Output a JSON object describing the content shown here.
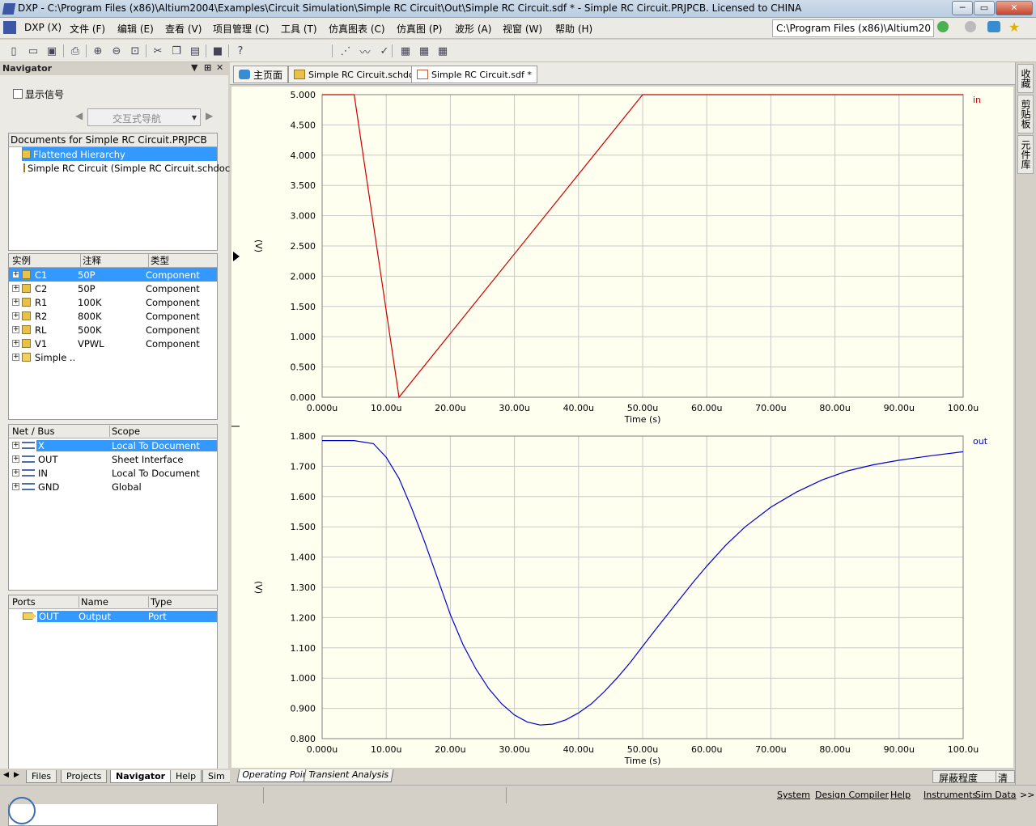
{
  "window": {
    "title": "DXP - C:\\Program Files (x86)\\Altium2004\\Examples\\Circuit Simulation\\Simple RC Circuit\\Out\\Simple RC Circuit.sdf * - Simple RC Circuit.PRJPCB. Licensed to CHINA",
    "buttons": {
      "minimize": "─",
      "maximize": "▭",
      "close": "✕"
    }
  },
  "menu": {
    "items": [
      {
        "label": "DXP (X)"
      },
      {
        "label": "文件 (F)"
      },
      {
        "label": "编辑 (E)"
      },
      {
        "label": "查看 (V)"
      },
      {
        "label": "项目管理 (C)"
      },
      {
        "label": "工具 (T)"
      },
      {
        "label": "仿真图表 (C)"
      },
      {
        "label": "仿真图 (P)"
      },
      {
        "label": "波形 (A)"
      },
      {
        "label": "视窗 (W)"
      },
      {
        "label": "帮助 (H)"
      }
    ],
    "path": "C:\\Program Files (x86)\\Altium20"
  },
  "navigator": {
    "title": "Navigator",
    "show_signals": "显示信号",
    "interactive_nav": "交互式导航",
    "documents": {
      "header": "Documents for Simple RC Circuit.PRJPCB",
      "items": [
        "Flattened Hierarchy",
        "Simple RC Circuit (Simple RC Circuit.schdoc)"
      ]
    },
    "instances": {
      "headers": [
        "实例",
        "注释",
        "类型"
      ],
      "rows": [
        [
          "C1",
          "50P",
          "Component"
        ],
        [
          "C2",
          "50P",
          "Component"
        ],
        [
          "R1",
          "100K",
          "Component"
        ],
        [
          "R2",
          "800K",
          "Component"
        ],
        [
          "RL",
          "500K",
          "Component"
        ],
        [
          "V1",
          "VPWL",
          "Component"
        ],
        [
          "Simple ...",
          "",
          ""
        ]
      ]
    },
    "nets": {
      "headers": [
        "Net / Bus",
        "Scope"
      ],
      "rows": [
        [
          "X",
          "Local To Document"
        ],
        [
          "OUT",
          "Sheet Interface"
        ],
        [
          "IN",
          "Local To Document"
        ],
        [
          "GND",
          "Global"
        ]
      ]
    },
    "ports": {
      "headers": [
        "Ports",
        "Name",
        "Type"
      ],
      "rows": [
        [
          "OUT",
          "Output",
          "Port"
        ]
      ]
    },
    "bottom_tabs": [
      "Files",
      "Projects",
      "Navigator",
      "Help",
      "Sim"
    ]
  },
  "doc_tabs": [
    "主页面",
    "Simple RC Circuit.schdoc",
    "Simple RC Circuit.sdf *"
  ],
  "sheet_tabs": [
    "Operating Point",
    "Transient Analysis"
  ],
  "sheet_buttons": [
    "屏蔽程度",
    "清除"
  ],
  "right_tabs": [
    "收藏",
    "剪贴板",
    "元件库"
  ],
  "status_buttons": [
    "System",
    "Design Compiler",
    "Help",
    "Instruments",
    "Sim Data",
    ">>"
  ],
  "chart_data": [
    {
      "type": "line",
      "ylabel": "(V)",
      "xlabel": "Time (s)",
      "ylim": [
        0,
        5
      ],
      "xlim": [
        0,
        100
      ],
      "yticks": [
        "0.000",
        "0.500",
        "1.000",
        "1.500",
        "2.000",
        "2.500",
        "3.000",
        "3.500",
        "4.000",
        "4.500",
        "5.000"
      ],
      "xticks": [
        "0.000u",
        "10.00u",
        "20.00u",
        "30.00u",
        "40.00u",
        "50.00u",
        "60.00u",
        "70.00u",
        "80.00u",
        "90.00u",
        "100.0u"
      ],
      "grid": true,
      "series": [
        {
          "name": "in",
          "color": "#cc0000",
          "x": [
            0,
            5,
            12,
            50,
            100
          ],
          "y": [
            5,
            5,
            0,
            5,
            5
          ]
        }
      ]
    },
    {
      "type": "line",
      "ylabel": "(V)",
      "xlabel": "Time (s)",
      "ylim": [
        0.8,
        1.8
      ],
      "xlim": [
        0,
        100
      ],
      "yticks": [
        "0.800",
        "0.900",
        "1.000",
        "1.100",
        "1.200",
        "1.300",
        "1.400",
        "1.500",
        "1.600",
        "1.700",
        "1.800"
      ],
      "xticks": [
        "0.000u",
        "10.00u",
        "20.00u",
        "30.00u",
        "40.00u",
        "50.00u",
        "60.00u",
        "70.00u",
        "80.00u",
        "90.00u",
        "100.0u"
      ],
      "grid": true,
      "series": [
        {
          "name": "out",
          "color": "#0000cc",
          "x": [
            0,
            5,
            8,
            10,
            12,
            14,
            16,
            18,
            20,
            22,
            24,
            26,
            28,
            30,
            32,
            34,
            36,
            38,
            40,
            42,
            44,
            46,
            48,
            50,
            52,
            55,
            58,
            60,
            63,
            66,
            70,
            74,
            78,
            82,
            86,
            90,
            95,
            100
          ],
          "y": [
            1.785,
            1.785,
            1.775,
            1.73,
            1.66,
            1.56,
            1.45,
            1.33,
            1.21,
            1.11,
            1.03,
            0.965,
            0.915,
            0.878,
            0.855,
            0.845,
            0.848,
            0.862,
            0.885,
            0.915,
            0.955,
            1.0,
            1.05,
            1.105,
            1.16,
            1.24,
            1.32,
            1.37,
            1.44,
            1.5,
            1.565,
            1.615,
            1.655,
            1.685,
            1.705,
            1.72,
            1.735,
            1.748
          ]
        }
      ]
    }
  ]
}
